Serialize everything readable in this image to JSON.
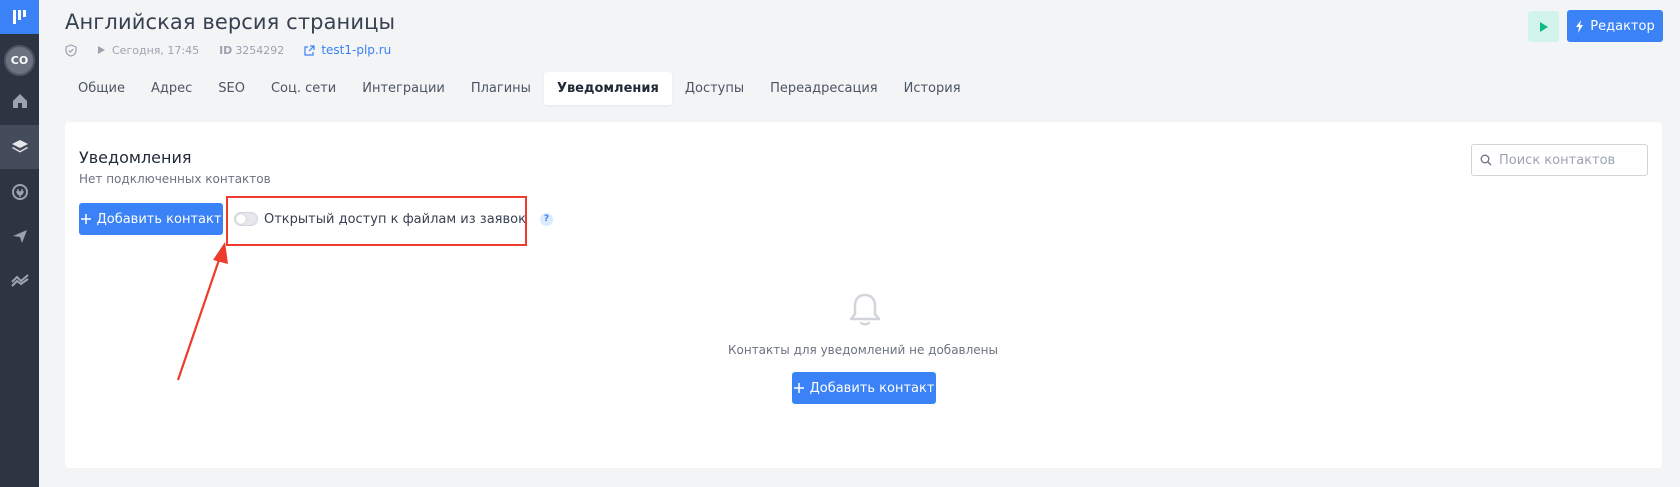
{
  "sidebar": {
    "avatar": "CO",
    "items": [
      {
        "name": "home-icon"
      },
      {
        "name": "layers-icon"
      },
      {
        "name": "plug-icon"
      },
      {
        "name": "send-icon"
      },
      {
        "name": "analytics-icon"
      }
    ]
  },
  "header": {
    "title": "Английская версия страницы",
    "published": "Сегодня, 17:45",
    "id_label": "ID",
    "id_value": "3254292",
    "domain": "test1-plp.ru",
    "editor_label": "Редактор"
  },
  "tabs": [
    {
      "label": "Общие"
    },
    {
      "label": "Адрес"
    },
    {
      "label": "SEO"
    },
    {
      "label": "Соц. сети"
    },
    {
      "label": "Интеграции"
    },
    {
      "label": "Плагины"
    },
    {
      "label": "Уведомления",
      "active": true
    },
    {
      "label": "Доступы"
    },
    {
      "label": "Переадресация"
    },
    {
      "label": "История"
    }
  ],
  "notifications": {
    "title": "Уведомления",
    "subtitle": "Нет подключенных контактов",
    "add_contact_label": "Добавить контакт",
    "toggle_label": "Открытый доступ к файлам из заявок",
    "toggle_on": false,
    "help": "?",
    "search_placeholder": "Поиск контактов",
    "search_value": "",
    "empty_text": "Контакты для уведомлений не добавлены",
    "empty_add_label": "Добавить контакт"
  },
  "colors": {
    "sidebar_bg": "#2e3442",
    "accent": "#3b82f6",
    "annotation": "#ef3b2c"
  }
}
